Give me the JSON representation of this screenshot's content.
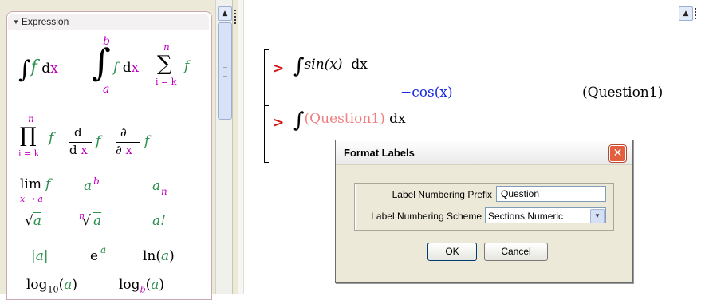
{
  "palette": {
    "title": "Expression",
    "items": {
      "int_f": "f",
      "dx": "dx",
      "int_upper": "b",
      "int_lower": "a",
      "int_f2": "f",
      "dx2": "dx",
      "sum_upper": "n",
      "sum_lower": "i = k",
      "sum_f": "f",
      "prod_upper": "n",
      "prod_lower": "i = k",
      "prod_f": "f",
      "d_num": "d",
      "d_den": "d x",
      "d_f": "f",
      "partial_num": "∂",
      "partial_den": "∂ x",
      "partial_f": "f",
      "lim": "lim",
      "lim_sub": "x → a",
      "lim_f": "f",
      "pow_base": "a",
      "pow_exp": "b",
      "subscript_base": "a",
      "subscript_sub": "n",
      "sqrt_arg": "a",
      "nroot_index": "n",
      "nroot_arg": "a",
      "factorial": "a!",
      "abs": "|a|",
      "exp_base": "e",
      "exp_exp": "a",
      "ln": "ln(",
      "ln_arg": "a",
      "ln_close": ")",
      "log10": "log",
      "log10_sub": "10",
      "log10_arg": "a",
      "logb": "log",
      "logb_sub": "b",
      "logb_arg": "a"
    }
  },
  "worksheet": {
    "input1": {
      "prompt": ">",
      "integral": "∫",
      "expr": "sin(x)",
      "dx": "dx"
    },
    "output1": {
      "value": "−cos(x)",
      "label": "(Question1)"
    },
    "input2": {
      "prompt": ">",
      "integral": "∫",
      "expr": "(Question1)",
      "dx": "dx"
    }
  },
  "dialog": {
    "title": "Format Labels",
    "close_glyph": "✕",
    "prefix_label": "Label Numbering Prefix",
    "prefix_value": "Question",
    "scheme_label": "Label Numbering Scheme",
    "scheme_value": "Sections Numeric",
    "ok_label": "OK",
    "cancel_label": "Cancel"
  },
  "colors": {
    "prompt": "#d21818",
    "output_blue": "#1a2ce0",
    "label_pink": "#f08080",
    "palette_green": "#2b8f4e",
    "palette_magenta": "#c000c0"
  }
}
